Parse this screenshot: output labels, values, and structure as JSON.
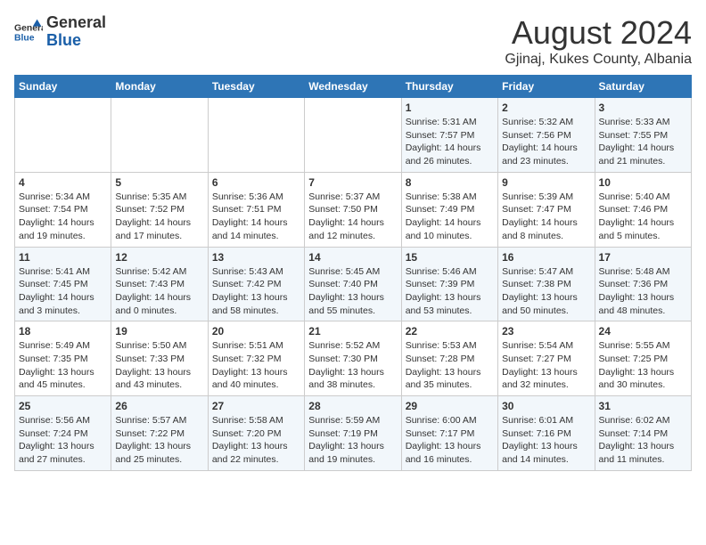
{
  "header": {
    "logo": {
      "general": "General",
      "blue": "Blue"
    },
    "title": "August 2024",
    "subtitle": "Gjinaj, Kukes County, Albania"
  },
  "calendar": {
    "weekdays": [
      "Sunday",
      "Monday",
      "Tuesday",
      "Wednesday",
      "Thursday",
      "Friday",
      "Saturday"
    ],
    "weeks": [
      [
        {
          "day": "",
          "info": ""
        },
        {
          "day": "",
          "info": ""
        },
        {
          "day": "",
          "info": ""
        },
        {
          "day": "",
          "info": ""
        },
        {
          "day": "1",
          "info": "Sunrise: 5:31 AM\nSunset: 7:57 PM\nDaylight: 14 hours\nand 26 minutes."
        },
        {
          "day": "2",
          "info": "Sunrise: 5:32 AM\nSunset: 7:56 PM\nDaylight: 14 hours\nand 23 minutes."
        },
        {
          "day": "3",
          "info": "Sunrise: 5:33 AM\nSunset: 7:55 PM\nDaylight: 14 hours\nand 21 minutes."
        }
      ],
      [
        {
          "day": "4",
          "info": "Sunrise: 5:34 AM\nSunset: 7:54 PM\nDaylight: 14 hours\nand 19 minutes."
        },
        {
          "day": "5",
          "info": "Sunrise: 5:35 AM\nSunset: 7:52 PM\nDaylight: 14 hours\nand 17 minutes."
        },
        {
          "day": "6",
          "info": "Sunrise: 5:36 AM\nSunset: 7:51 PM\nDaylight: 14 hours\nand 14 minutes."
        },
        {
          "day": "7",
          "info": "Sunrise: 5:37 AM\nSunset: 7:50 PM\nDaylight: 14 hours\nand 12 minutes."
        },
        {
          "day": "8",
          "info": "Sunrise: 5:38 AM\nSunset: 7:49 PM\nDaylight: 14 hours\nand 10 minutes."
        },
        {
          "day": "9",
          "info": "Sunrise: 5:39 AM\nSunset: 7:47 PM\nDaylight: 14 hours\nand 8 minutes."
        },
        {
          "day": "10",
          "info": "Sunrise: 5:40 AM\nSunset: 7:46 PM\nDaylight: 14 hours\nand 5 minutes."
        }
      ],
      [
        {
          "day": "11",
          "info": "Sunrise: 5:41 AM\nSunset: 7:45 PM\nDaylight: 14 hours\nand 3 minutes."
        },
        {
          "day": "12",
          "info": "Sunrise: 5:42 AM\nSunset: 7:43 PM\nDaylight: 14 hours\nand 0 minutes."
        },
        {
          "day": "13",
          "info": "Sunrise: 5:43 AM\nSunset: 7:42 PM\nDaylight: 13 hours\nand 58 minutes."
        },
        {
          "day": "14",
          "info": "Sunrise: 5:45 AM\nSunset: 7:40 PM\nDaylight: 13 hours\nand 55 minutes."
        },
        {
          "day": "15",
          "info": "Sunrise: 5:46 AM\nSunset: 7:39 PM\nDaylight: 13 hours\nand 53 minutes."
        },
        {
          "day": "16",
          "info": "Sunrise: 5:47 AM\nSunset: 7:38 PM\nDaylight: 13 hours\nand 50 minutes."
        },
        {
          "day": "17",
          "info": "Sunrise: 5:48 AM\nSunset: 7:36 PM\nDaylight: 13 hours\nand 48 minutes."
        }
      ],
      [
        {
          "day": "18",
          "info": "Sunrise: 5:49 AM\nSunset: 7:35 PM\nDaylight: 13 hours\nand 45 minutes."
        },
        {
          "day": "19",
          "info": "Sunrise: 5:50 AM\nSunset: 7:33 PM\nDaylight: 13 hours\nand 43 minutes."
        },
        {
          "day": "20",
          "info": "Sunrise: 5:51 AM\nSunset: 7:32 PM\nDaylight: 13 hours\nand 40 minutes."
        },
        {
          "day": "21",
          "info": "Sunrise: 5:52 AM\nSunset: 7:30 PM\nDaylight: 13 hours\nand 38 minutes."
        },
        {
          "day": "22",
          "info": "Sunrise: 5:53 AM\nSunset: 7:28 PM\nDaylight: 13 hours\nand 35 minutes."
        },
        {
          "day": "23",
          "info": "Sunrise: 5:54 AM\nSunset: 7:27 PM\nDaylight: 13 hours\nand 32 minutes."
        },
        {
          "day": "24",
          "info": "Sunrise: 5:55 AM\nSunset: 7:25 PM\nDaylight: 13 hours\nand 30 minutes."
        }
      ],
      [
        {
          "day": "25",
          "info": "Sunrise: 5:56 AM\nSunset: 7:24 PM\nDaylight: 13 hours\nand 27 minutes."
        },
        {
          "day": "26",
          "info": "Sunrise: 5:57 AM\nSunset: 7:22 PM\nDaylight: 13 hours\nand 25 minutes."
        },
        {
          "day": "27",
          "info": "Sunrise: 5:58 AM\nSunset: 7:20 PM\nDaylight: 13 hours\nand 22 minutes."
        },
        {
          "day": "28",
          "info": "Sunrise: 5:59 AM\nSunset: 7:19 PM\nDaylight: 13 hours\nand 19 minutes."
        },
        {
          "day": "29",
          "info": "Sunrise: 6:00 AM\nSunset: 7:17 PM\nDaylight: 13 hours\nand 16 minutes."
        },
        {
          "day": "30",
          "info": "Sunrise: 6:01 AM\nSunset: 7:16 PM\nDaylight: 13 hours\nand 14 minutes."
        },
        {
          "day": "31",
          "info": "Sunrise: 6:02 AM\nSunset: 7:14 PM\nDaylight: 13 hours\nand 11 minutes."
        }
      ]
    ]
  }
}
